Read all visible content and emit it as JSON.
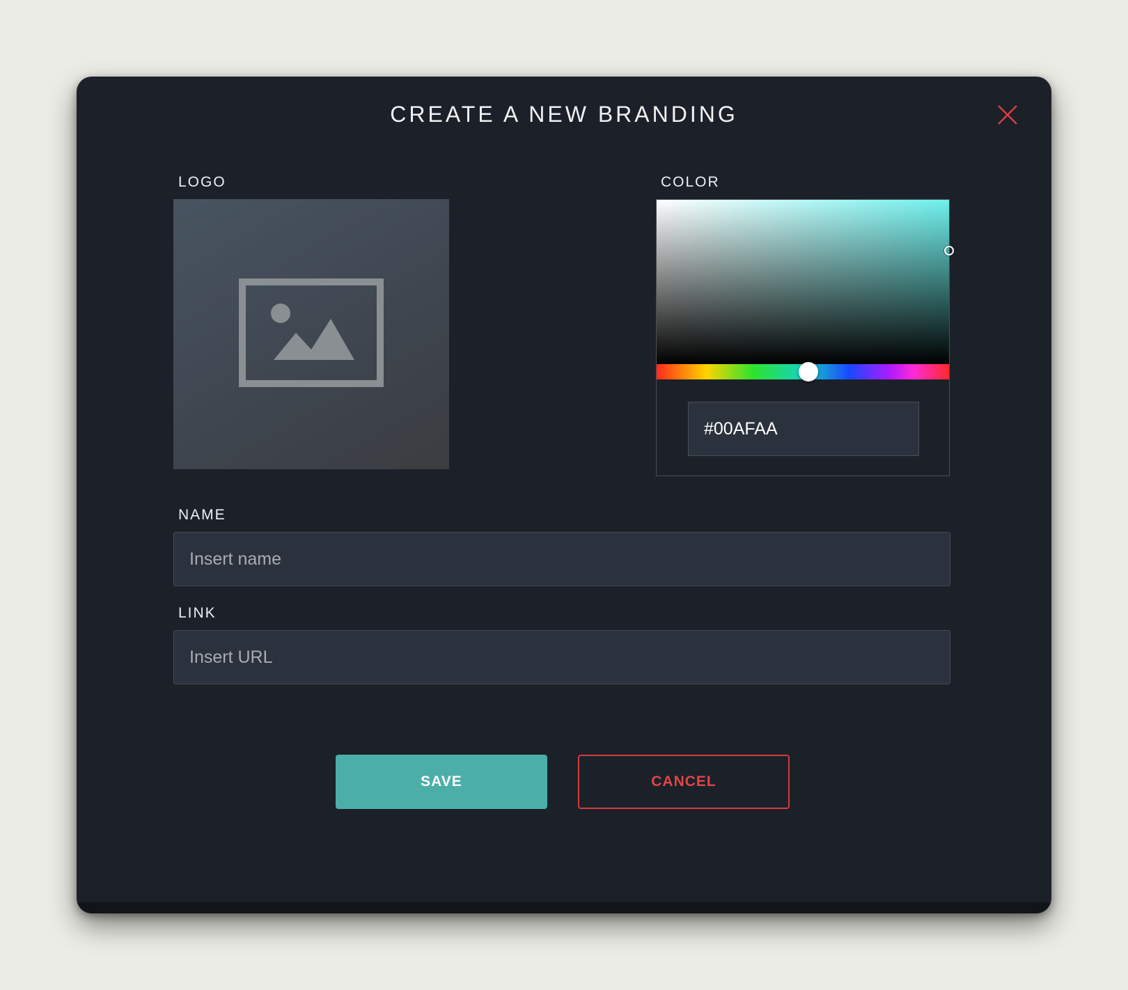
{
  "dialog": {
    "title": "CREATE A NEW BRANDING",
    "close_icon": "close-icon"
  },
  "logo": {
    "label": "LOGO",
    "placeholder_icon": "image-placeholder-icon"
  },
  "color": {
    "label": "COLOR",
    "hex_value": "#00AFAA",
    "hue_position": 0.52,
    "saturation": 1.0,
    "brightness": 0.69
  },
  "name": {
    "label": "NAME",
    "placeholder": "Insert name",
    "value": ""
  },
  "link": {
    "label": "LINK",
    "placeholder": "Insert URL",
    "value": ""
  },
  "actions": {
    "save_label": "SAVE",
    "cancel_label": "CANCEL"
  },
  "colors": {
    "modal_background": "#1c2029",
    "accent_save": "#4caea9",
    "accent_cancel": "#d13d3d",
    "close_icon": "#d94040"
  }
}
